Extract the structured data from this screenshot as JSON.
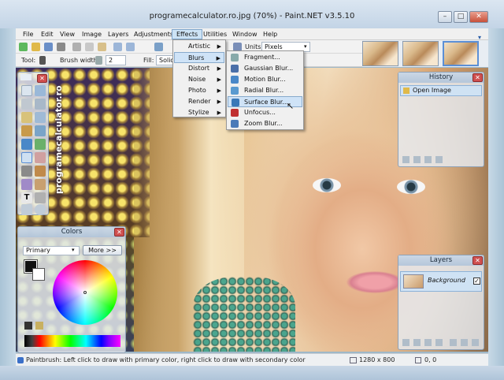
{
  "window": {
    "title": "programecalculator.ro.jpg (70%) - Paint.NET v3.5.10",
    "minimize": "–",
    "maximize": "□",
    "close": "✕"
  },
  "menu": [
    "File",
    "Edit",
    "View",
    "Image",
    "Layers",
    "Adjustments",
    "Effects",
    "Utilities",
    "Window",
    "Help"
  ],
  "toolbar": {
    "units_label": "Units:",
    "units_value": "Pixels",
    "tool_label": "Tool:",
    "brush_label": "Brush width:",
    "brush_value": "2",
    "fill_label": "Fill:",
    "fill_value": "Solid"
  },
  "effects_menu": {
    "items": [
      "Artistic",
      "Blurs",
      "Distort",
      "Noise",
      "Photo",
      "Render",
      "Stylize"
    ],
    "highlighted": "Blurs"
  },
  "blurs_menu": {
    "items": [
      "Fragment...",
      "Gaussian Blur...",
      "Motion Blur...",
      "Radial Blur...",
      "Surface Blur...",
      "Unfocus...",
      "Zoom Blur..."
    ],
    "highlighted": "Surface Blur..."
  },
  "watermark": "programecalculator.ro",
  "colors_panel": {
    "title": "Colors",
    "mode": "Primary",
    "more_button": "More >>"
  },
  "history_panel": {
    "title": "History",
    "items": [
      "Open Image"
    ]
  },
  "layers_panel": {
    "title": "Layers",
    "items": [
      "Background"
    ]
  },
  "statusbar": {
    "message": "Paintbrush: Left click to draw with primary color, right click to draw with secondary color",
    "size": "1280 x 800",
    "position": "0, 0"
  },
  "colors": {
    "accent": "#5b8fd6",
    "menu_highlight": "#cfe3f7",
    "close_red": "#d05050"
  }
}
